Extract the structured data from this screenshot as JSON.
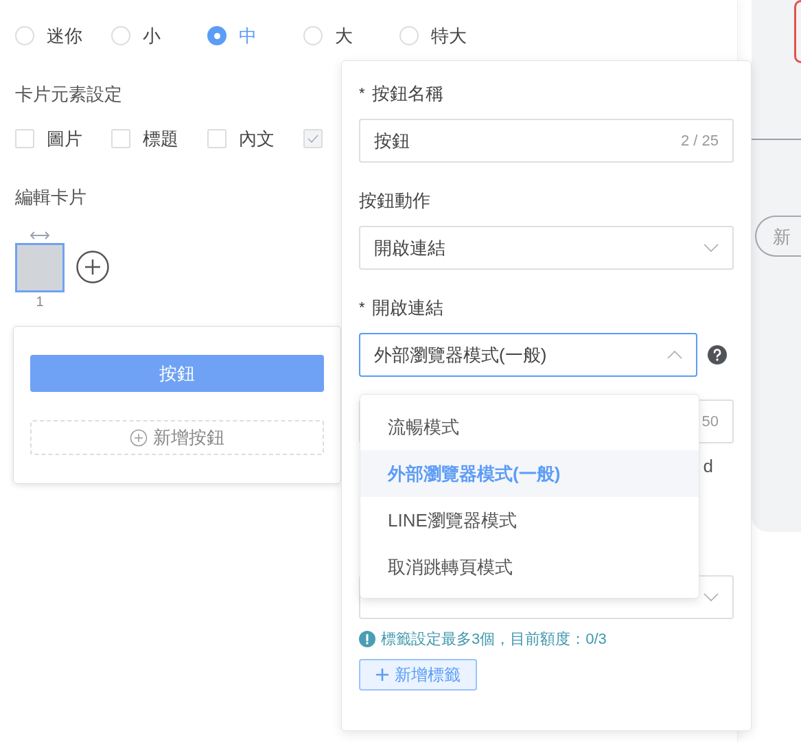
{
  "size_options": [
    {
      "label": "迷你",
      "selected": false
    },
    {
      "label": "小",
      "selected": false
    },
    {
      "label": "中",
      "selected": true
    },
    {
      "label": "大",
      "selected": false
    },
    {
      "label": "特大",
      "selected": false
    }
  ],
  "element_settings": {
    "title": "卡片元素設定",
    "options": [
      {
        "label": "圖片",
        "checked": false,
        "disabled": false
      },
      {
        "label": "標題",
        "checked": false,
        "disabled": false
      },
      {
        "label": "內文",
        "checked": false,
        "disabled": false
      },
      {
        "checked": true,
        "disabled": true
      }
    ]
  },
  "card_editor": {
    "title": "編輯卡片",
    "cards": [
      {
        "number": "1",
        "selected": true
      }
    ],
    "buttons": [
      "按鈕"
    ],
    "add_button": "新增按鈕"
  },
  "button_popover": {
    "name_field": {
      "required_mark": "*",
      "label": "按鈕名稱",
      "value": "按鈕",
      "count": "2 / 25"
    },
    "action_field": {
      "label": "按鈕動作",
      "value": "開啟連結",
      "expanded": false
    },
    "link_mode_field": {
      "required_mark": "*",
      "label": "開啟連結",
      "value": "外部瀏覽器模式(一般)",
      "expanded": true,
      "options": [
        {
          "label": "流暢模式",
          "selected": false
        },
        {
          "label": "外部瀏覽器模式(一般)",
          "selected": true
        },
        {
          "label": "LINE瀏覽器模式",
          "selected": false
        },
        {
          "label": "取消跳轉頁模式",
          "selected": false
        }
      ]
    },
    "covered_field_count": "50",
    "covered_text": "d",
    "tag_select": {
      "expanded": false
    },
    "tag_hint": "標籤設定最多3個，目前額度：0/3",
    "add_tag_button": "新增標籤"
  },
  "preview": {
    "add_pill": "新"
  }
}
